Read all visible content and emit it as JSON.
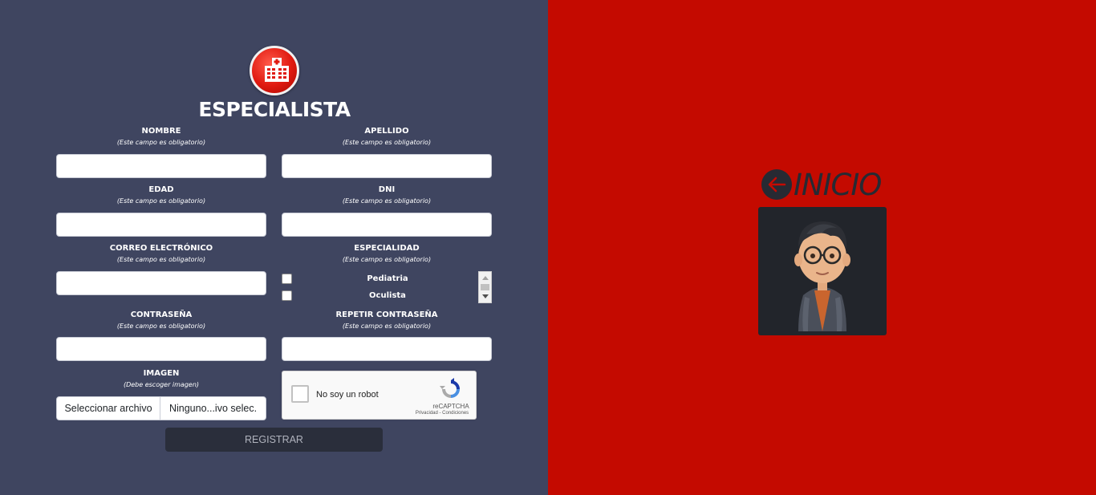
{
  "form": {
    "title": "ESPECIALISTA",
    "required_hint": "(Este campo es obligatorio)",
    "image_hint": "(Debe escoger imagen)",
    "fields": {
      "nombre": "NOMBRE",
      "apellido": "APELLIDO",
      "edad": "EDAD",
      "dni": "DNI",
      "correo": "CORREO ELECTRÓNICO",
      "especialidad": "ESPECIALIDAD",
      "contrasena": "CONTRASEÑA",
      "repetir": "REPETIR CONTRASEÑA",
      "imagen": "IMAGEN"
    },
    "especialidades": [
      "Pediatria",
      "Oculista"
    ],
    "file": {
      "button_label": "Seleccionar archivo",
      "status": "Ninguno...ivo selec."
    },
    "captcha": {
      "label": "No soy un robot",
      "brand": "reCAPTCHA",
      "privacy": "Privacidad - Condiciones"
    },
    "submit_label": "REGISTRAR"
  },
  "side": {
    "nav_label": "INICIO",
    "back_icon": "arrow-left-icon",
    "avatar": "cartoon-person-avatar"
  },
  "colors": {
    "left_bg": "#3f4560",
    "right_bg": "#c40a00",
    "button_bg": "#2a2e3b"
  }
}
